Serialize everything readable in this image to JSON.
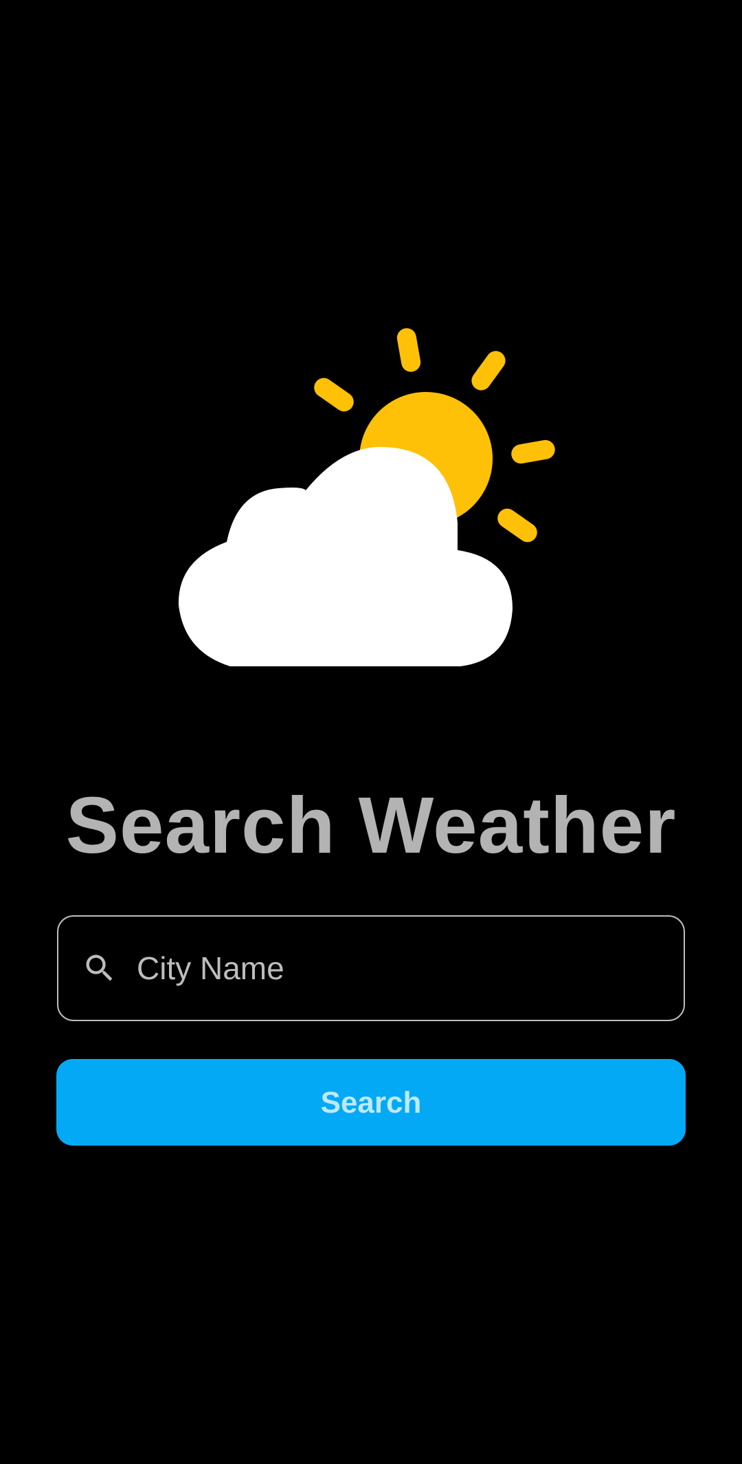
{
  "header": {
    "title": "Search Weather"
  },
  "illustration": {
    "icon": "partly-cloudy-icon",
    "sun_color": "#FFC107",
    "cloud_color": "#FFFFFF"
  },
  "search": {
    "icon": "search-icon",
    "placeholder": "City Name",
    "value": ""
  },
  "button": {
    "label": "Search",
    "color": "#03A9F4"
  },
  "theme": {
    "background": "#000000",
    "title_color": "#B3B3B3"
  }
}
